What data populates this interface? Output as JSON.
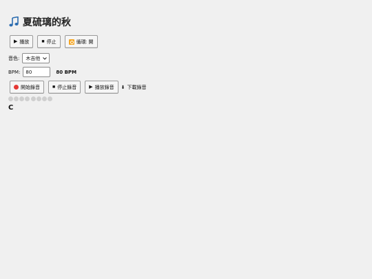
{
  "header": {
    "icon": "music-note-icon",
    "title": "夏硫璃的秋"
  },
  "controls": {
    "play_label": "播放",
    "stop_label": "停止",
    "loop_label": "循環: 開",
    "play_icon": "▶",
    "stop_icon": "■"
  },
  "timbre": {
    "label": "音色:",
    "selected": "木吉他"
  },
  "bpm": {
    "label": "BPM:",
    "value": "80",
    "display": "80 BPM"
  },
  "recording": {
    "start_label": "開始錄音",
    "stop_label": "停止錄音",
    "play_label": "播放錄音",
    "download_label": "下載錄音",
    "stop_icon": "■",
    "play_icon": "▶",
    "download_icon": "⬇"
  },
  "beats": {
    "count": 8
  },
  "current_chord": "C",
  "colors": {
    "record": "#e53935",
    "loop": "#f5a623",
    "beat_inactive": "#cfcfcf"
  }
}
